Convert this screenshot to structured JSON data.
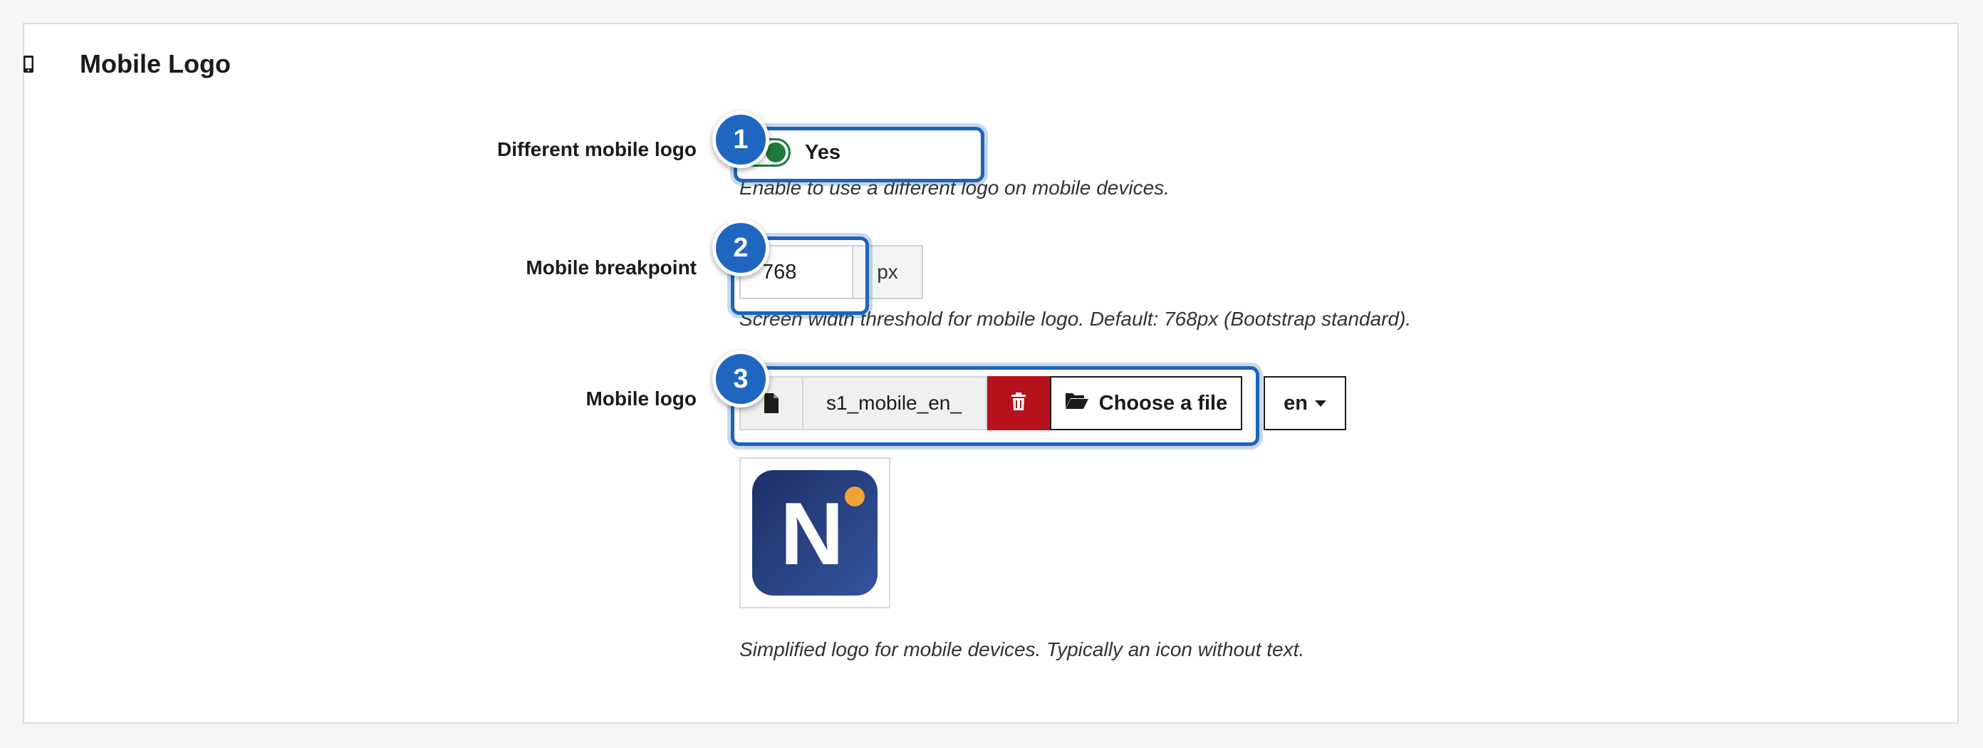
{
  "section": {
    "title": "Mobile Logo",
    "icon": "mobile-phone-icon"
  },
  "fields": {
    "different_logo": {
      "label": "Different mobile logo",
      "toggle_text": "Yes",
      "enabled": true,
      "help": "Enable to use a different logo on mobile devices."
    },
    "breakpoint": {
      "label": "Mobile breakpoint",
      "value": "768",
      "unit": "px",
      "help": "Screen width threshold for mobile logo. Default: 768px (Bootstrap standard)."
    },
    "mobile_logo": {
      "label": "Mobile logo",
      "filename": "s1_mobile_en_",
      "choose_label": "Choose a file",
      "language": "en",
      "preview_letter": "N",
      "help": "Simplified logo for mobile devices. Typically an icon without text."
    }
  },
  "annotations": {
    "badge_1": "1",
    "badge_2": "2",
    "badge_3": "3"
  },
  "colors": {
    "accent_blue": "#1f66c1",
    "toggle_green": "#1d7a3c",
    "danger_red": "#b5121b",
    "logo_dark_blue": "#223a78",
    "logo_dot_orange": "#f2a23a"
  }
}
